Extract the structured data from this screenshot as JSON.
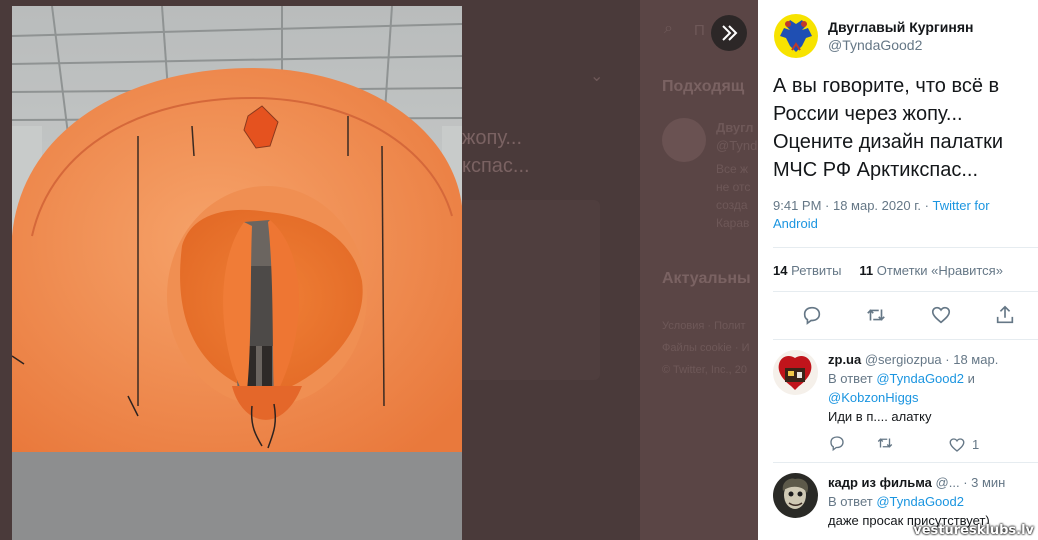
{
  "background": {
    "search_placeholder": "П",
    "section_suggested": "Подходящ",
    "tweet_fragment_1": "жопу...",
    "tweet_fragment_2": "кспас...",
    "user_name_fragment": "Двугл",
    "user_handle_fragment": "@Tynd",
    "bio_lines": [
      "Все ж",
      "не отс",
      "созда",
      "Карав"
    ],
    "section_trending": "Актуальны",
    "footer_lines": [
      "Условия · Полит",
      "Файлы cookie · И",
      "© Twitter, Inc., 20"
    ]
  },
  "tweet": {
    "display_name": "Двуглавый Кургинян",
    "handle": "@TyndaGood2",
    "text": "А вы говорите, что всё в России через жопу... Оцените дизайн палатки МЧС РФ Арктикспас...",
    "time": "9:41 PM · 18 мар. 2020 г. · ",
    "source": "Twitter for Android",
    "retweets_count": "14",
    "retweets_label": "Ретвиты",
    "likes_count": "11",
    "likes_label": "Отметки «Нравится»"
  },
  "replies": [
    {
      "name": "zp.ua",
      "handle": "@sergiozpua",
      "time": "· 18 мар.",
      "reply_prefix": "В ответ",
      "reply_to_1": "@TyndaGood2",
      "reply_and": "и",
      "reply_to_2": "@KobzonHiggs",
      "text": "Иди в п.... алатку",
      "retweets": "",
      "likes": "1"
    },
    {
      "name": "кадр из фильма",
      "handle": "@...",
      "time": "· 3 мин",
      "reply_prefix": "В ответ",
      "reply_to_1": "@TyndaGood2",
      "text": "даже просак присутствует)"
    }
  ],
  "watermark": "vesturesklubs.lv",
  "colors": {
    "tent_orange": "#f2894a",
    "link_blue": "#1b95e0"
  }
}
